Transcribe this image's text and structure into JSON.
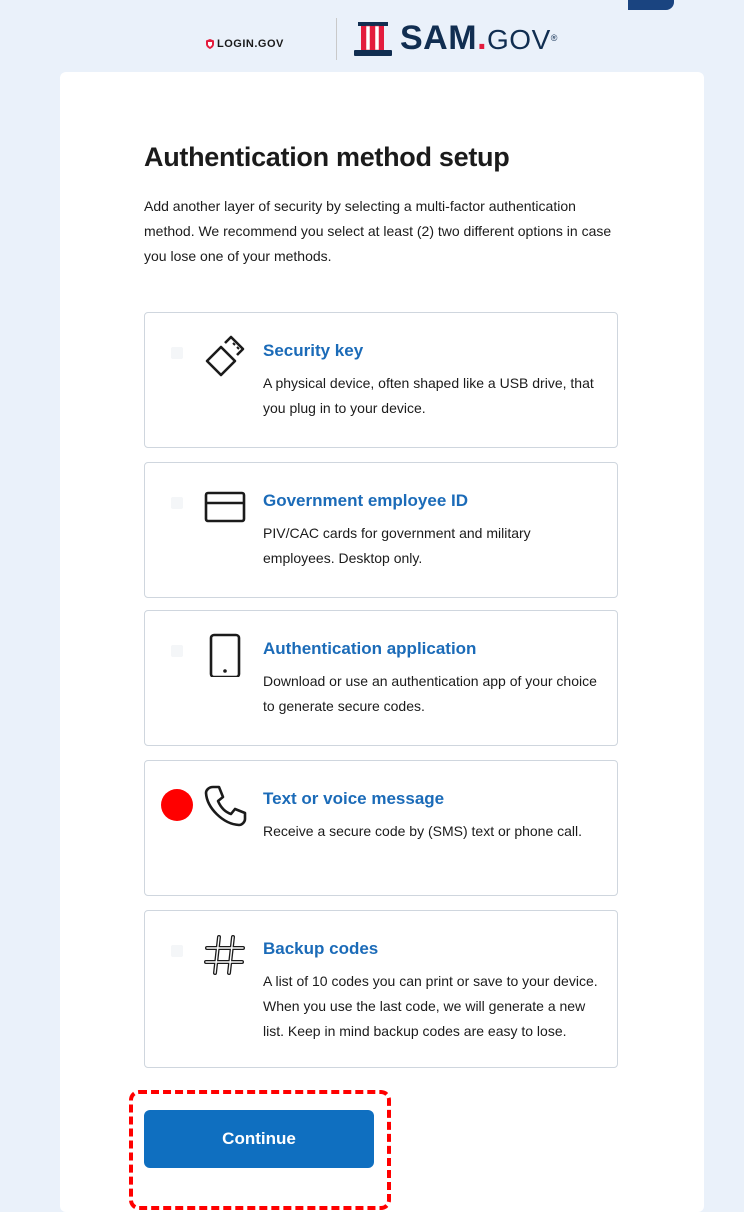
{
  "header": {
    "login_logo": "LOGIN.GOV",
    "sam_logo_main": "SAM",
    "sam_logo_dot": ".",
    "sam_logo_gov": "GOV",
    "sam_logo_mark": "®"
  },
  "page": {
    "title": "Authentication method setup",
    "intro": "Add another layer of security by selecting a multi-factor authentication method. We recommend you select at least (2) two different options in case you lose one of your methods."
  },
  "options": [
    {
      "title": "Security key",
      "desc": "A physical device, often shaped like a USB drive, that you plug in to your device.",
      "icon": "usb-key-icon"
    },
    {
      "title": "Government employee ID",
      "desc": "PIV/CAC cards for government and military employees. Desktop only.",
      "icon": "id-card-icon"
    },
    {
      "title": "Authentication application",
      "desc": "Download or use an authentication app of your choice to generate secure codes.",
      "icon": "phone-device-icon"
    },
    {
      "title": "Text or voice message",
      "desc": "Receive a secure code by (SMS) text or phone call.",
      "icon": "phone-call-icon"
    },
    {
      "title": "Backup codes",
      "desc": "A list of 10 codes you can print or save to your device. When you use the last code, we will generate a new list. Keep in mind backup codes are easy to lose.",
      "icon": "hash-icon"
    }
  ],
  "actions": {
    "continue_label": "Continue"
  },
  "colors": {
    "accent": "#1b6bb8",
    "button": "#0f6fc0",
    "highlight": "#ff0000"
  }
}
